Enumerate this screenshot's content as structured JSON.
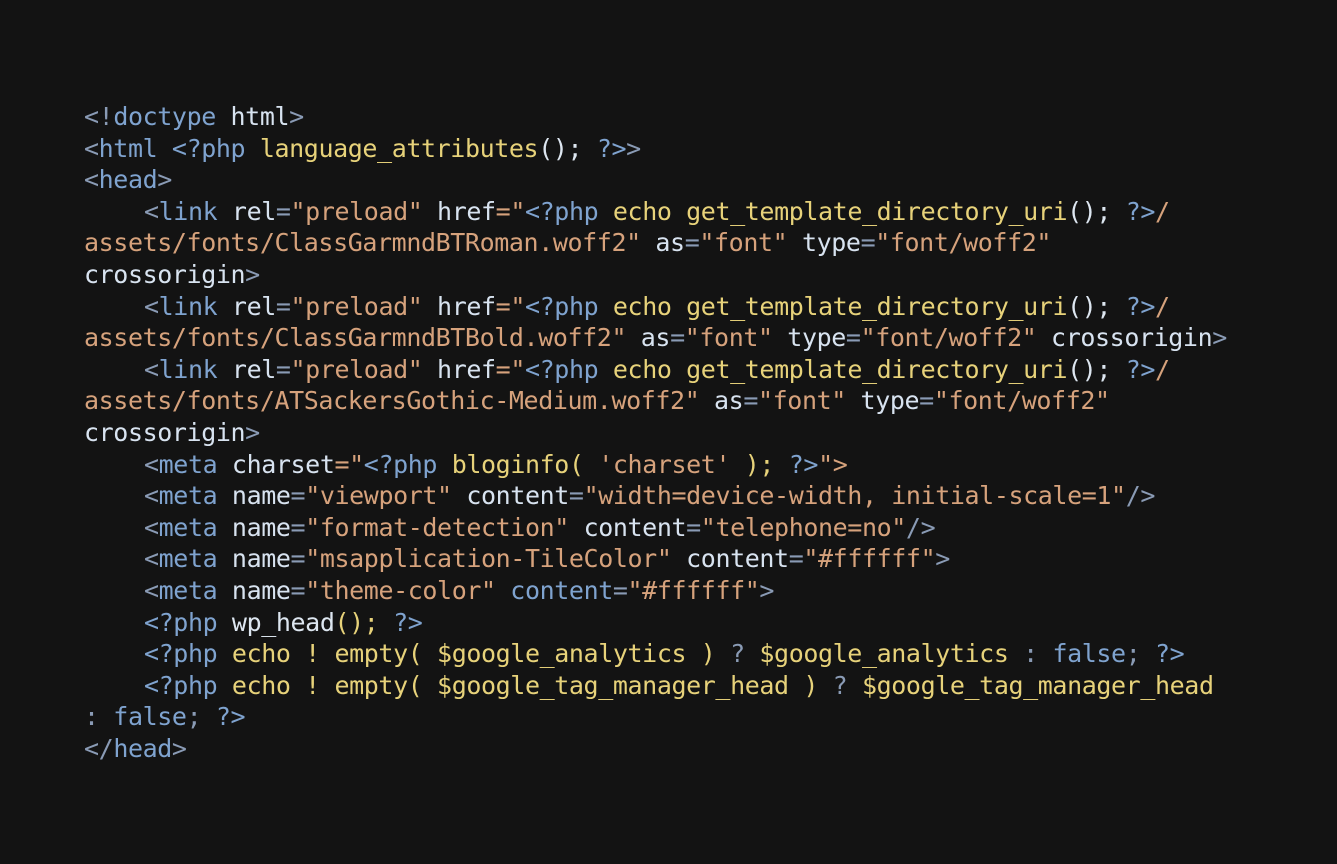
{
  "colors": {
    "background": "#131313",
    "delim": "#8a9bb5",
    "tag": "#7fa3cf",
    "attr": "#d8e3f0",
    "string": "#d6a27c",
    "func": "#e7d27a",
    "text": "#dde6f0",
    "php": "#7fa3cf",
    "op": "#8a9bb5"
  },
  "code_lines": [
    {
      "indent": false,
      "tokens": [
        [
          "<!",
          "delim"
        ],
        [
          "doctype",
          "tag"
        ],
        [
          " html",
          "attr"
        ],
        [
          ">",
          "delim"
        ]
      ]
    },
    {
      "indent": false,
      "tokens": [
        [
          "<",
          "delim"
        ],
        [
          "html",
          "tag"
        ],
        [
          " <?php",
          "php"
        ],
        [
          " language_attributes",
          "func"
        ],
        [
          "();",
          "text"
        ],
        [
          " ?>",
          "php"
        ],
        [
          ">",
          "delim"
        ]
      ]
    },
    {
      "indent": false,
      "tokens": [
        [
          "<",
          "delim"
        ],
        [
          "head",
          "tag"
        ],
        [
          ">",
          "delim"
        ]
      ]
    },
    {
      "indent": true,
      "tokens": [
        [
          "<",
          "delim"
        ],
        [
          "link",
          "tag"
        ],
        [
          " rel",
          "attr"
        ],
        [
          "=",
          "op"
        ],
        [
          "\"preload\"",
          "string"
        ],
        [
          " href",
          "attr"
        ],
        [
          "=\"",
          "string"
        ],
        [
          "<?php",
          "php"
        ],
        [
          " echo get_template_directory_uri",
          "func"
        ],
        [
          "();",
          "text"
        ],
        [
          " ?>",
          "php"
        ],
        [
          "/",
          "string"
        ]
      ]
    },
    {
      "indent": false,
      "tokens": [
        [
          "assets/fonts/ClassGarmndBTRoman.woff2\"",
          "string"
        ],
        [
          " as",
          "attr"
        ],
        [
          "=",
          "op"
        ],
        [
          "\"font\"",
          "string"
        ],
        [
          " type",
          "attr"
        ],
        [
          "=",
          "op"
        ],
        [
          "\"font/woff2\"",
          "string"
        ]
      ]
    },
    {
      "indent": false,
      "tokens": [
        [
          "crossorigin",
          "attr"
        ],
        [
          ">",
          "delim"
        ]
      ]
    },
    {
      "indent": true,
      "tokens": [
        [
          "<",
          "delim"
        ],
        [
          "link",
          "tag"
        ],
        [
          " rel",
          "attr"
        ],
        [
          "=",
          "op"
        ],
        [
          "\"preload\"",
          "string"
        ],
        [
          " href",
          "attr"
        ],
        [
          "=\"",
          "string"
        ],
        [
          "<?php",
          "php"
        ],
        [
          " echo get_template_directory_uri",
          "func"
        ],
        [
          "();",
          "text"
        ],
        [
          " ?>",
          "php"
        ],
        [
          "/",
          "string"
        ]
      ]
    },
    {
      "indent": false,
      "tokens": [
        [
          "assets/fonts/ClassGarmndBTBold.woff2\"",
          "string"
        ],
        [
          " as",
          "attr"
        ],
        [
          "=",
          "op"
        ],
        [
          "\"font\"",
          "string"
        ],
        [
          " type",
          "attr"
        ],
        [
          "=",
          "op"
        ],
        [
          "\"font/woff2\"",
          "string"
        ],
        [
          " crossorigin",
          "attr"
        ],
        [
          ">",
          "delim"
        ]
      ]
    },
    {
      "indent": true,
      "tokens": [
        [
          "<",
          "delim"
        ],
        [
          "link",
          "tag"
        ],
        [
          " rel",
          "attr"
        ],
        [
          "=",
          "op"
        ],
        [
          "\"preload\"",
          "string"
        ],
        [
          " href",
          "attr"
        ],
        [
          "=\"",
          "string"
        ],
        [
          "<?php",
          "php"
        ],
        [
          " echo get_template_directory_uri",
          "func"
        ],
        [
          "();",
          "text"
        ],
        [
          " ?>",
          "php"
        ],
        [
          "/",
          "string"
        ]
      ]
    },
    {
      "indent": false,
      "tokens": [
        [
          "assets/fonts/ATSackersGothic-Medium.woff2\"",
          "string"
        ],
        [
          " as",
          "attr"
        ],
        [
          "=",
          "op"
        ],
        [
          "\"font\"",
          "string"
        ],
        [
          " type",
          "attr"
        ],
        [
          "=",
          "op"
        ],
        [
          "\"font/woff2\"",
          "string"
        ]
      ]
    },
    {
      "indent": false,
      "tokens": [
        [
          "crossorigin",
          "attr"
        ],
        [
          ">",
          "delim"
        ]
      ]
    },
    {
      "indent": true,
      "tokens": [
        [
          "<",
          "delim"
        ],
        [
          "meta",
          "tag"
        ],
        [
          " charset",
          "attr"
        ],
        [
          "=\"",
          "string"
        ],
        [
          "<?php",
          "php"
        ],
        [
          " bloginfo",
          "func"
        ],
        [
          "( ",
          "func"
        ],
        [
          "'charset'",
          "string"
        ],
        [
          " );",
          "func"
        ],
        [
          " ?>",
          "php"
        ],
        [
          "\">",
          "string"
        ]
      ]
    },
    {
      "indent": true,
      "tokens": [
        [
          "<",
          "delim"
        ],
        [
          "meta",
          "tag"
        ],
        [
          " name",
          "attr"
        ],
        [
          "=",
          "op"
        ],
        [
          "\"viewport\"",
          "string"
        ],
        [
          " content",
          "attr"
        ],
        [
          "=",
          "op"
        ],
        [
          "\"width=device-width, initial-scale=1\"",
          "string"
        ],
        [
          "/>",
          "delim"
        ]
      ]
    },
    {
      "indent": true,
      "tokens": [
        [
          "<",
          "delim"
        ],
        [
          "meta",
          "tag"
        ],
        [
          " name",
          "attr"
        ],
        [
          "=",
          "op"
        ],
        [
          "\"format-detection\"",
          "string"
        ],
        [
          " content",
          "attr"
        ],
        [
          "=",
          "op"
        ],
        [
          "\"telephone=no\"",
          "string"
        ],
        [
          "/>",
          "delim"
        ]
      ]
    },
    {
      "indent": true,
      "tokens": [
        [
          "<",
          "delim"
        ],
        [
          "meta",
          "tag"
        ],
        [
          " name",
          "attr"
        ],
        [
          "=",
          "op"
        ],
        [
          "\"msapplication-TileColor\"",
          "string"
        ],
        [
          " content",
          "attr"
        ],
        [
          "=",
          "op"
        ],
        [
          "\"#ffffff\"",
          "string"
        ],
        [
          ">",
          "delim"
        ]
      ]
    },
    {
      "indent": true,
      "tokens": [
        [
          "<",
          "delim"
        ],
        [
          "meta",
          "tag"
        ],
        [
          " name",
          "attr"
        ],
        [
          "=",
          "op"
        ],
        [
          "\"theme-color\"",
          "string"
        ],
        [
          " content",
          "tag"
        ],
        [
          "=",
          "op"
        ],
        [
          "\"#ffffff\"",
          "string"
        ],
        [
          ">",
          "delim"
        ]
      ]
    },
    {
      "indent": true,
      "tokens": [
        [
          "<?php",
          "php"
        ],
        [
          " wp_head",
          "text"
        ],
        [
          "();",
          "func"
        ],
        [
          " ?>",
          "php"
        ]
      ]
    },
    {
      "indent": true,
      "tokens": [
        [
          "<?php",
          "php"
        ],
        [
          " echo ! empty",
          "func"
        ],
        [
          "( ",
          "func"
        ],
        [
          "$google_analytics",
          "func"
        ],
        [
          " )",
          "func"
        ],
        [
          " ?",
          "op"
        ],
        [
          " $google_analytics",
          "func"
        ],
        [
          " :",
          "op"
        ],
        [
          " false",
          "php"
        ],
        [
          ";",
          "op"
        ],
        [
          " ?>",
          "php"
        ]
      ]
    },
    {
      "indent": true,
      "tokens": [
        [
          "<?php",
          "php"
        ],
        [
          " echo ! empty",
          "func"
        ],
        [
          "( ",
          "func"
        ],
        [
          "$google_tag_manager_head",
          "func"
        ],
        [
          " )",
          "func"
        ],
        [
          " ?",
          "op"
        ],
        [
          " $google_tag_manager_head",
          "func"
        ]
      ]
    },
    {
      "indent": false,
      "tokens": [
        [
          ":",
          "op"
        ],
        [
          " false",
          "php"
        ],
        [
          ";",
          "op"
        ],
        [
          " ?>",
          "php"
        ]
      ]
    },
    {
      "indent": false,
      "tokens": [
        [
          "</",
          "delim"
        ],
        [
          "head",
          "tag"
        ],
        [
          ">",
          "delim"
        ]
      ]
    }
  ]
}
